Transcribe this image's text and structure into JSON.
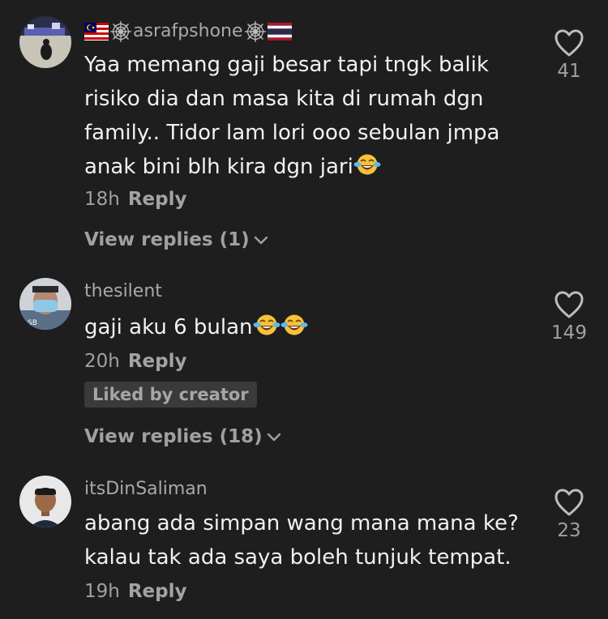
{
  "comments": [
    {
      "username": "asrafpshone",
      "flag_left": "flag-malaysia",
      "flag_right": "flag-thailand",
      "text_lines": [
        "Yaa memang gaji besar tapi tngk balik",
        "risiko dia dan masa kita di rumah dgn",
        "family.. Tidor lam lori ooo sebulan jmpa",
        "anak bini blh kira dgn jari"
      ],
      "time": "18h",
      "reply_label": "Reply",
      "view_replies": "View replies (1)",
      "likes": "41"
    },
    {
      "username": "thesilent",
      "text": "gaji aku 6 bulan",
      "time": "20h",
      "reply_label": "Reply",
      "badge": "Liked by creator",
      "view_replies": "View replies (18)",
      "likes": "149"
    },
    {
      "username": "itsDinSaliman",
      "text_lines": [
        "abang ada simpan wang mana mana ke?",
        "kalau tak ada saya boleh tunjuk tempat."
      ],
      "time": "19h",
      "reply_label": "Reply",
      "likes": "23"
    }
  ],
  "icons": {
    "like": "heart-outline-icon",
    "expand": "chevron-down-icon",
    "emoji": "tears-of-joy-emoji",
    "decor": "spider-web-icon"
  },
  "colors": {
    "background": "#1e1e1e",
    "text": "#f1f1f1",
    "muted": "#a0a0a0",
    "badge_bg": "#3a3a3a"
  }
}
